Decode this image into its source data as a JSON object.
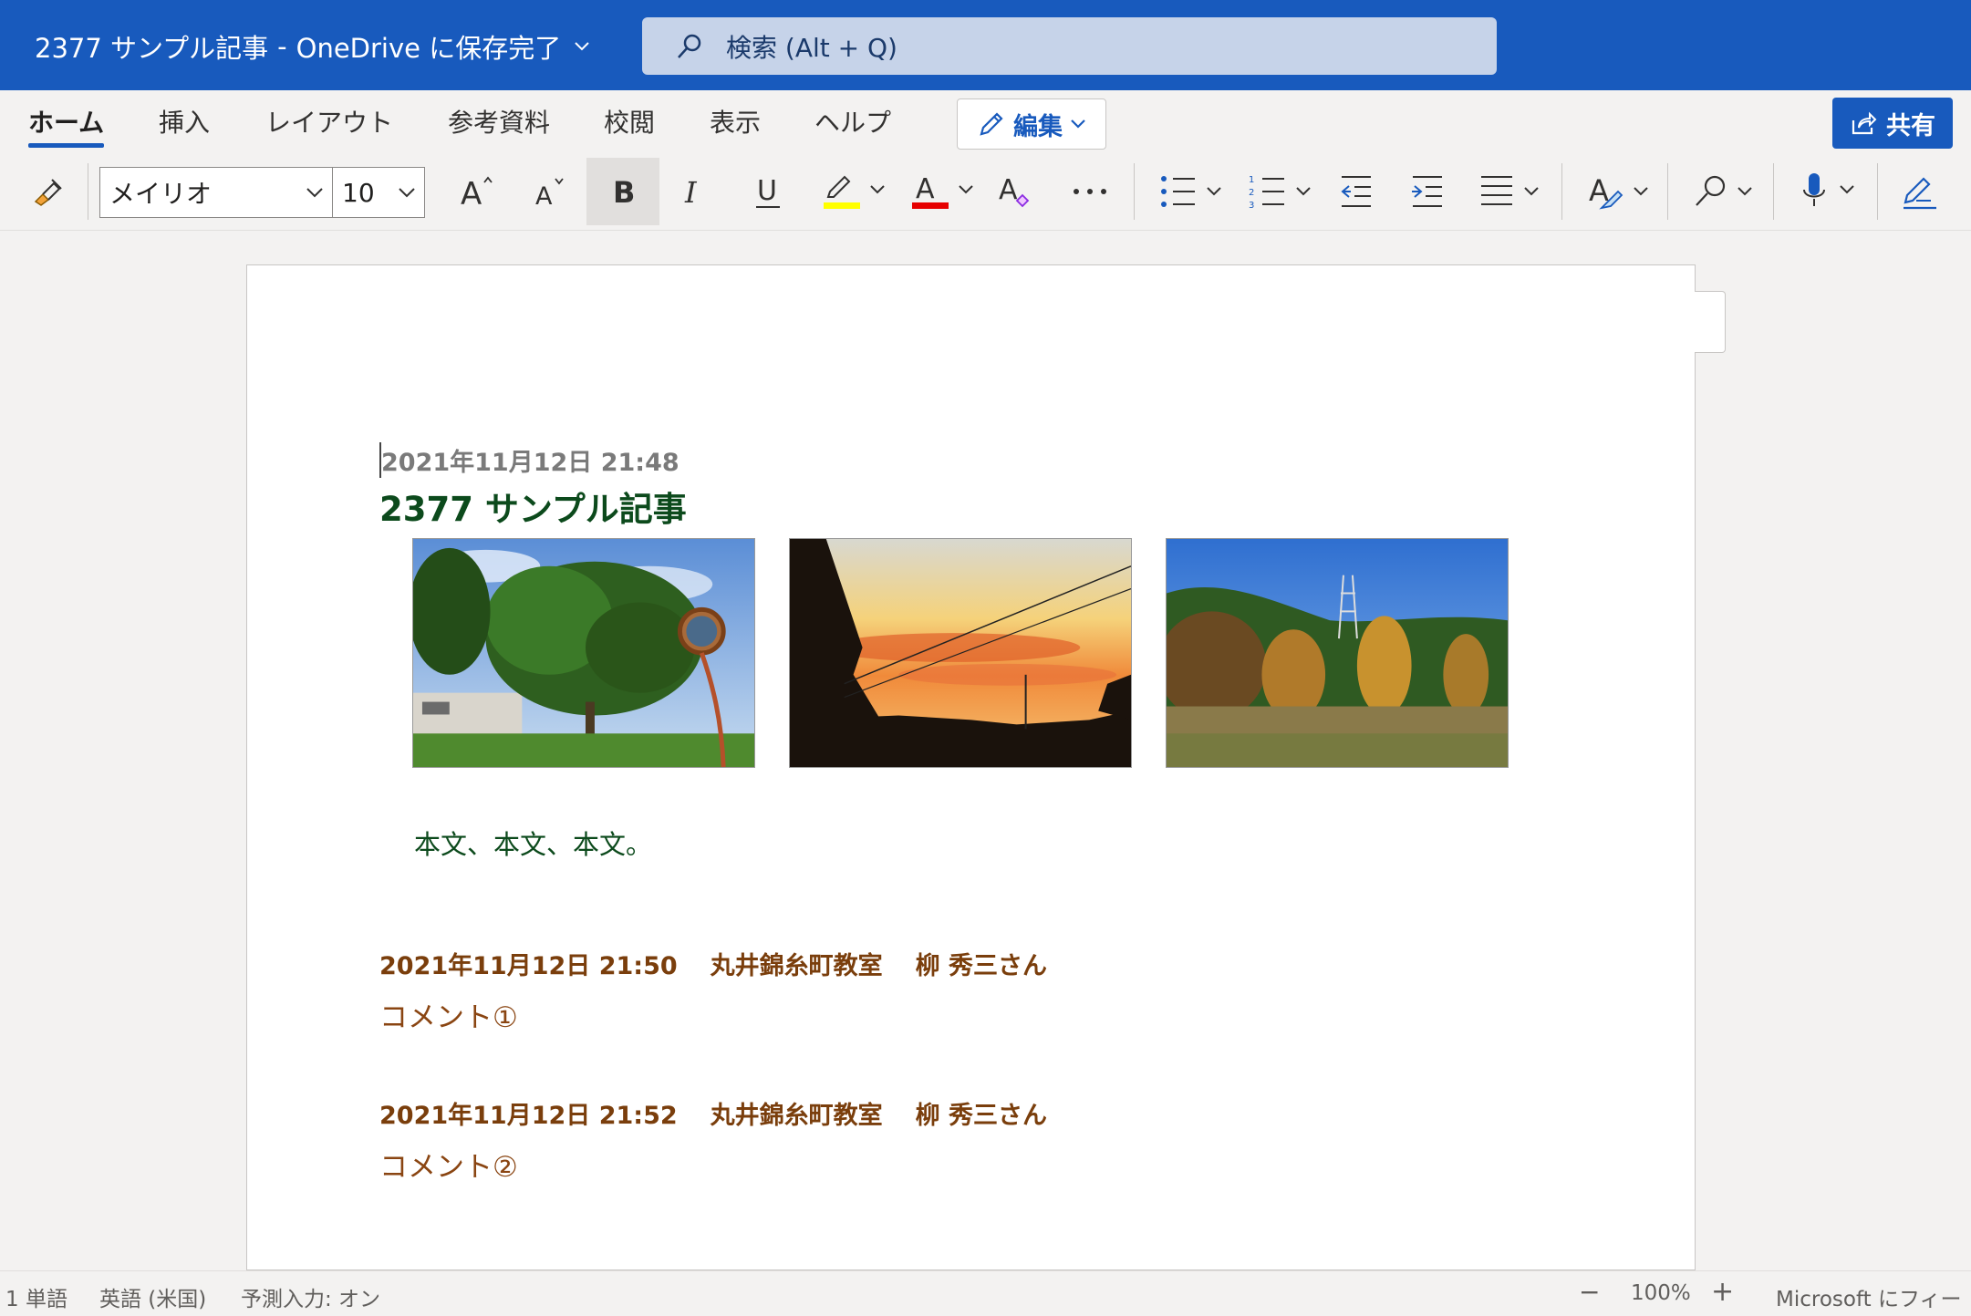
{
  "titlebar": {
    "document_title": "2377 サンプル記事",
    "separator": "-",
    "save_status": "OneDrive に保存完了",
    "search_placeholder": "検索 (Alt + Q)"
  },
  "ribbon": {
    "tabs": [
      {
        "label": "ホーム",
        "active": true
      },
      {
        "label": "挿入"
      },
      {
        "label": "レイアウト"
      },
      {
        "label": "参考資料"
      },
      {
        "label": "校閲"
      },
      {
        "label": "表示"
      },
      {
        "label": "ヘルプ"
      }
    ],
    "edit_button": "編集",
    "share_button": "共有"
  },
  "toolbar": {
    "font_name": "メイリオ",
    "font_size": "10",
    "highlight_color": "#ffff00",
    "font_color": "#e60000",
    "icons": [
      "format-painter-icon",
      "grow-font-icon",
      "shrink-font-icon",
      "bold-icon",
      "italic-icon",
      "underline-icon",
      "highlight-icon",
      "font-color-icon",
      "clear-format-icon",
      "more-icon",
      "bullets-icon",
      "numbering-icon",
      "decrease-indent-icon",
      "increase-indent-icon",
      "align-icon",
      "styles-icon",
      "find-icon",
      "dictate-icon",
      "editor-icon"
    ]
  },
  "document": {
    "date_line": "2021年11月12日 21:48",
    "heading": "2377 サンプル記事",
    "photos": [
      "tree-mirror-photo",
      "sunset-photo",
      "park-autumn-photo"
    ],
    "body": "本文、本文、本文。",
    "comments": [
      {
        "date": "2021年11月12日 21:50",
        "place": "丸井錦糸町教室",
        "author": "柳 秀三さん",
        "text": "コメント①"
      },
      {
        "date": "2021年11月12日 21:52",
        "place": "丸井錦糸町教室",
        "author": "柳 秀三さん",
        "text": "コメント②"
      }
    ]
  },
  "statusbar": {
    "word_count": "1 単語",
    "language": "英語 (米国)",
    "prediction": "予測入力: オン",
    "zoom_out": "−",
    "zoom": "100%",
    "zoom_in": "+",
    "feedback": "Microsoft にフィー"
  },
  "colors": {
    "brand": "#185abd",
    "heading": "#0c4a1c",
    "comment_meta": "#7a3e0c",
    "comment_text": "#8a4512"
  }
}
